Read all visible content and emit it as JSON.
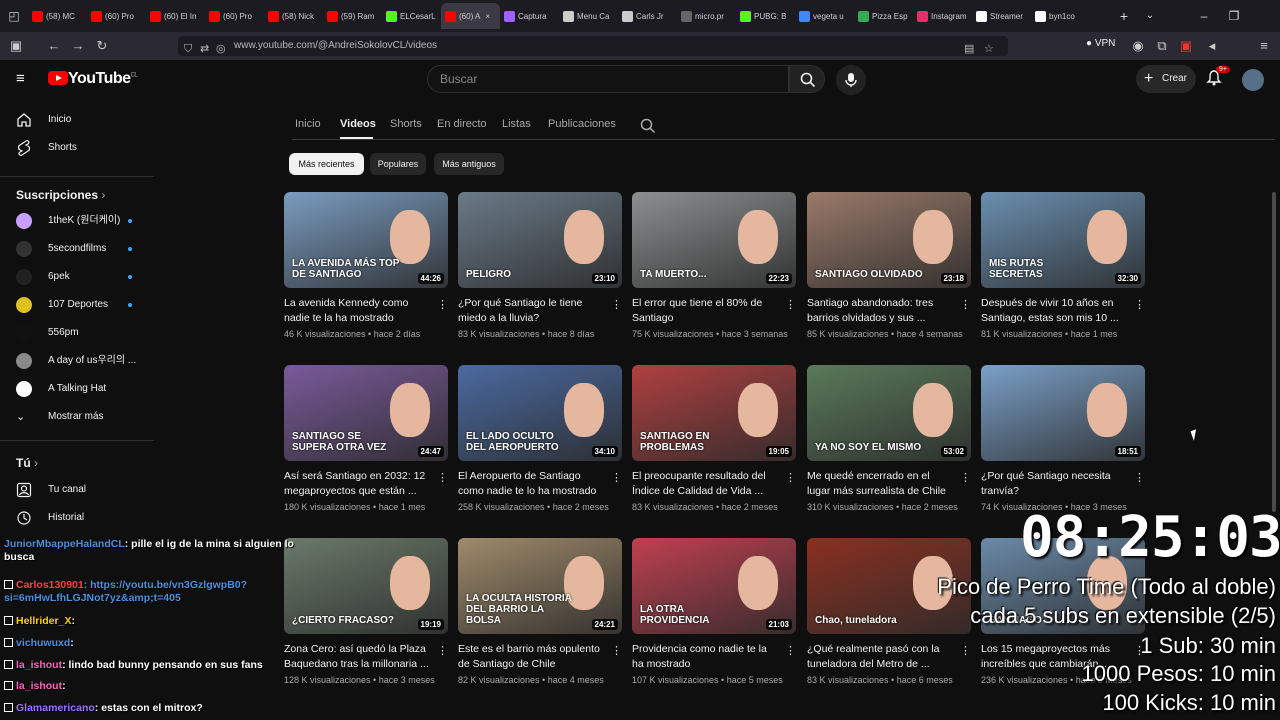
{
  "browser": {
    "tabs": [
      {
        "label": "(58) MC",
        "color": "#ff0000"
      },
      {
        "label": "(60) Pro",
        "color": "#ff0000"
      },
      {
        "label": "(60) El In",
        "color": "#ff0000"
      },
      {
        "label": "(60) Pro",
        "color": "#ff0000"
      },
      {
        "label": "(58) Nick",
        "color": "#ff0000"
      },
      {
        "label": "(59) Ram",
        "color": "#ff0000"
      },
      {
        "label": "ELCesarL",
        "color": "#53fc18"
      },
      {
        "label": "(60) A",
        "color": "#ff0000"
      },
      {
        "label": "Captura",
        "color": "#a060ff"
      },
      {
        "label": "Menu Ca",
        "color": "#cccccc"
      },
      {
        "label": "Carls Jr",
        "color": "#cccccc"
      },
      {
        "label": "micro.pr",
        "color": "#666666"
      },
      {
        "label": "PUBG: B",
        "color": "#53fc18"
      },
      {
        "label": "vegeta u",
        "color": "#4285f4"
      },
      {
        "label": "Pizza Esp",
        "color": "#34a853"
      },
      {
        "label": "Instagram",
        "color": "#e1306c"
      },
      {
        "label": "Streamer",
        "color": "#ffffff"
      },
      {
        "label": "byn1co",
        "color": "#ffffff"
      }
    ],
    "url": "www.youtube.com/@AndreiSokolovCL/videos",
    "vpn_label": "VPN"
  },
  "youtube": {
    "logo": "YouTube",
    "logo_country": "CL",
    "search_placeholder": "Buscar",
    "create_label": "Crear",
    "notif_count": "9+",
    "sidebar": {
      "main": [
        {
          "label": "Inicio",
          "icon": "home-icon"
        },
        {
          "label": "Shorts",
          "icon": "shorts-icon"
        }
      ],
      "subs_heading": "Suscripciones",
      "subs": [
        {
          "label": "1theK (원더케이)",
          "color": "#c9a0ff",
          "live": true
        },
        {
          "label": "5secondfilms",
          "color": "#333333",
          "live": true
        },
        {
          "label": "6pek",
          "color": "#222222",
          "live": true
        },
        {
          "label": "107 Deportes",
          "color": "#e0c020",
          "live": true
        },
        {
          "label": "556pm",
          "color": "#111111",
          "live": false
        },
        {
          "label": "A day of us우리의 ...",
          "color": "#8a8a8a",
          "live": false
        },
        {
          "label": "A Talking Hat",
          "color": "#ffffff",
          "live": false
        }
      ],
      "show_more": "Mostrar más",
      "you_heading": "Tú",
      "you": [
        {
          "label": "Tu canal",
          "icon": "channel-icon"
        },
        {
          "label": "Historial",
          "icon": "history-icon"
        }
      ]
    },
    "channel_tabs": [
      "Inicio",
      "Videos",
      "Shorts",
      "En directo",
      "Listas",
      "Publicaciones"
    ],
    "active_tab": "Videos",
    "chips": [
      "Más recientes",
      "Populares",
      "Más antiguos"
    ],
    "videos": [
      {
        "title": "La avenida Kennedy como nadie te la ha mostrado",
        "meta": "46 K visualizaciones • hace 2 días",
        "duration": "44:26",
        "caption": "LA AVENIDA MÁS TOP DE SANTIAGO",
        "bg": "#7a9cc0"
      },
      {
        "title": "¿Por qué Santiago le tiene miedo a la lluvia?",
        "meta": "83 K visualizaciones • hace 8 días",
        "duration": "23:10",
        "caption": "PELIGRO",
        "bg": "#6a7a88"
      },
      {
        "title": "El error que tiene el 80% de Santiago",
        "meta": "75 K visualizaciones • hace 3 semanas",
        "duration": "22:23",
        "caption": "TA MUERTO...",
        "bg": "#8c8f90"
      },
      {
        "title": "Santiago abandonado: tres barrios olvidados y sus ...",
        "meta": "85 K visualizaciones • hace 4 semanas",
        "duration": "23:18",
        "caption": "SANTIAGO OLVIDADO",
        "bg": "#9a7a6a"
      },
      {
        "title": "Después de vivir 10 años en Santiago, estas son mis 10 ...",
        "meta": "81 K visualizaciones • hace 1 mes",
        "duration": "32:30",
        "caption": "MIS RUTAS SECRETAS",
        "bg": "#6a8fb0"
      },
      {
        "title": "Así será Santiago en 2032: 12 megaproyectos que están ...",
        "meta": "180 K visualizaciones • hace 1 mes",
        "duration": "24:47",
        "caption": "SANTIAGO SE SUPERA OTRA VEZ",
        "bg": "#7a5a9a"
      },
      {
        "title": "El Aeropuerto de Santiago como nadie te lo ha mostrado",
        "meta": "258 K visualizaciones • hace 2 meses",
        "duration": "34:10",
        "caption": "EL LADO OCULTO DEL AEROPUERTO",
        "bg": "#4a6aa0"
      },
      {
        "title": "El preocupante resultado del Índice de Calidad de Vida ...",
        "meta": "83 K visualizaciones • hace 2 meses",
        "duration": "19:05",
        "caption": "SANTIAGO EN PROBLEMAS",
        "bg": "#b04040"
      },
      {
        "title": "Me quedé encerrado en el lugar más surrealista de Chile",
        "meta": "310 K visualizaciones • hace 2 meses",
        "duration": "53:02",
        "caption": "YA NO SOY EL MISMO",
        "bg": "#5a7a5a"
      },
      {
        "title": "¿Por qué Santiago necesita tranvía?",
        "meta": "74 K visualizaciones • hace 3 meses",
        "duration": "18:51",
        "caption": "",
        "bg": "#7aa0c8"
      },
      {
        "title": "Zona Cero: así quedó la Plaza Baquedano tras la millonaria ...",
        "meta": "128 K visualizaciones • hace 3 meses",
        "duration": "19:19",
        "caption": "¿CIERTO FRACASO?",
        "bg": "#6a7a6a"
      },
      {
        "title": "Este es el barrio más opulento de Santiago de Chile",
        "meta": "82 K visualizaciones • hace 4 meses",
        "duration": "24:21",
        "caption": "LA OCULTA HISTORIA DEL BARRIO LA BOLSA",
        "bg": "#a08a6a"
      },
      {
        "title": "Providencia como nadie te la ha mostrado",
        "meta": "107 K visualizaciones • hace 5 meses",
        "duration": "21:03",
        "caption": "LA OTRA PROVIDENCIA",
        "bg": "#c04050"
      },
      {
        "title": "¿Qué realmente pasó con la tuneladora del Metro de ...",
        "meta": "83 K visualizaciones • hace 6 meses",
        "duration": "",
        "caption": "Chao, tuneladora",
        "bg": "#8a3020"
      },
      {
        "title": "Los 15 megaproyectos más increíbles que cambiarán ...",
        "meta": "236 K visualizaciones • hace 8 meses",
        "duration": "",
        "caption": "SANTIAGO",
        "bg": "#6a8aa8"
      }
    ]
  },
  "overlay": {
    "chat": [
      {
        "user": "JuniorMbappeHalandCL",
        "user_color": "#4a90e2",
        "text": ": pille el ig de la mina si alguien lo busca"
      },
      {
        "user": "Carlos130901",
        "user_color": "#ff4040",
        "text": ": https://youtu.be/vn3GzlgwpB0?si=6mHwLfhLGJNot7yz&amp;t=405"
      },
      {
        "user": "Hellrider_X",
        "user_color": "#ffd000",
        "text": ":"
      },
      {
        "user": "vichuwuxd",
        "user_color": "#4a90e2",
        "text": ":"
      },
      {
        "user": "la_ishout",
        "user_color": "#ff60c0",
        "text": ": lindo bad bunny pensando en sus fans"
      },
      {
        "user": "la_ishout",
        "user_color": "#ff60c0",
        "text": ":"
      },
      {
        "user": "Glamamericano",
        "user_color": "#a070ff",
        "text": ": estas con el mitrox?"
      }
    ],
    "timer": "08:25:03",
    "lines": [
      "Pico de Perro Time (Todo al doble)",
      "cada 5 subs en extensible (2/5)",
      "1 Sub: 30 min",
      "1000 Pesos: 10 min",
      "100 Kicks: 10 min"
    ]
  }
}
